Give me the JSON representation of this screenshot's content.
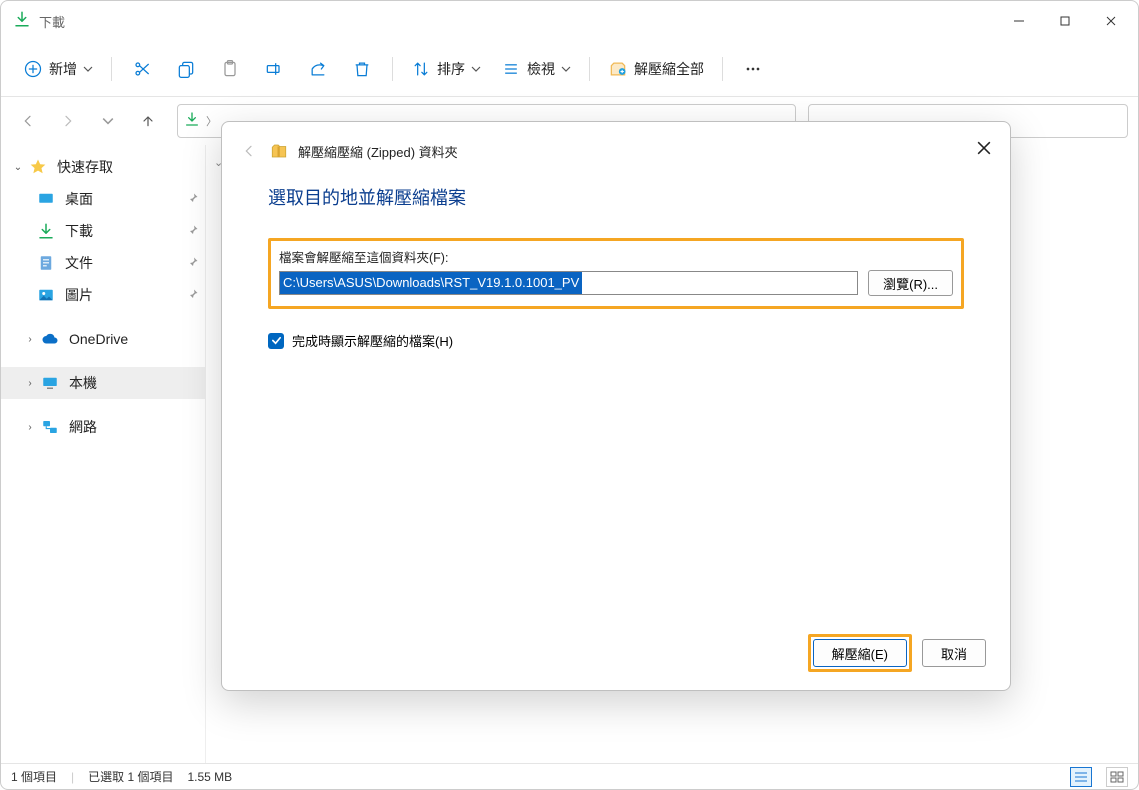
{
  "window": {
    "title": "下載"
  },
  "toolbar": {
    "new": "新增",
    "sort": "排序",
    "view": "檢視",
    "extract_all": "解壓縮全部"
  },
  "sidebar": {
    "quick": "快速存取",
    "desktop": "桌面",
    "downloads": "下載",
    "documents": "文件",
    "pictures": "圖片",
    "onedrive": "OneDrive",
    "thispc": "本機",
    "network": "網路"
  },
  "status": {
    "items": "1 個項目",
    "selected": "已選取 1 個項目",
    "size": "1.55 MB"
  },
  "modal": {
    "wizard_title": "解壓縮壓縮 (Zipped) 資料夾",
    "heading": "選取目的地並解壓縮檔案",
    "dest_label": "檔案會解壓縮至這個資料夾(F):",
    "dest_value": "C:\\Users\\ASUS\\Downloads\\RST_V19.1.0.1001_PV",
    "browse": "瀏覽(R)...",
    "show_label": "完成時顯示解壓縮的檔案(H)",
    "extract": "解壓縮(E)",
    "cancel": "取消"
  }
}
